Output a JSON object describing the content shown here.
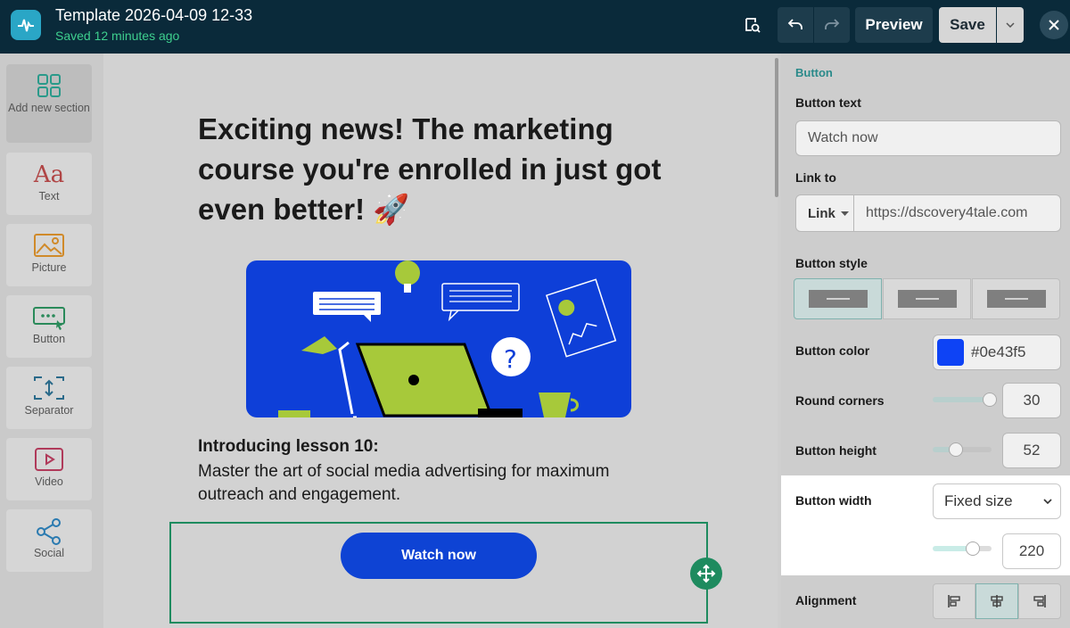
{
  "topbar": {
    "title": "Template 2026-04-09 12-33",
    "saved": "Saved 12 minutes ago",
    "preview_label": "Preview",
    "save_label": "Save"
  },
  "tools": [
    {
      "label": "Add new section",
      "icon": "grid-icon"
    },
    {
      "label": "Text",
      "icon": "text-aa-icon",
      "glyph": "Aa"
    },
    {
      "label": "Picture",
      "icon": "picture-icon"
    },
    {
      "label": "Button",
      "icon": "button-icon"
    },
    {
      "label": "Separator",
      "icon": "separator-icon"
    },
    {
      "label": "Video",
      "icon": "video-icon"
    },
    {
      "label": "Social",
      "icon": "share-icon"
    }
  ],
  "canvas": {
    "headline": "Exciting news! The marketing course you're enrolled in just got even better! 🚀",
    "lesson_title": "Introducing lesson 10:",
    "lesson_body": "Master the art of social media advertising for maximum outreach and engagement.",
    "button_label": "Watch now"
  },
  "panel": {
    "crumb": "Button",
    "button_text_label": "Button text",
    "button_text_value": "Watch now",
    "link_to_label": "Link to",
    "link_type": "Link",
    "link_url": "https://dscovery4tale.com",
    "button_style_label": "Button style",
    "button_color_label": "Button color",
    "button_color_value": "#0e43f5",
    "round_corners_label": "Round corners",
    "round_corners_value": "30",
    "button_height_label": "Button height",
    "button_height_value": "52",
    "button_width_label": "Button width",
    "button_width_mode": "Fixed size",
    "button_width_value": "220",
    "alignment_label": "Alignment"
  },
  "colors": {
    "topbar": "#0a2a3a",
    "accent": "#1e8b5f",
    "button": "#0e43f5",
    "saved": "#3ecf8e"
  }
}
